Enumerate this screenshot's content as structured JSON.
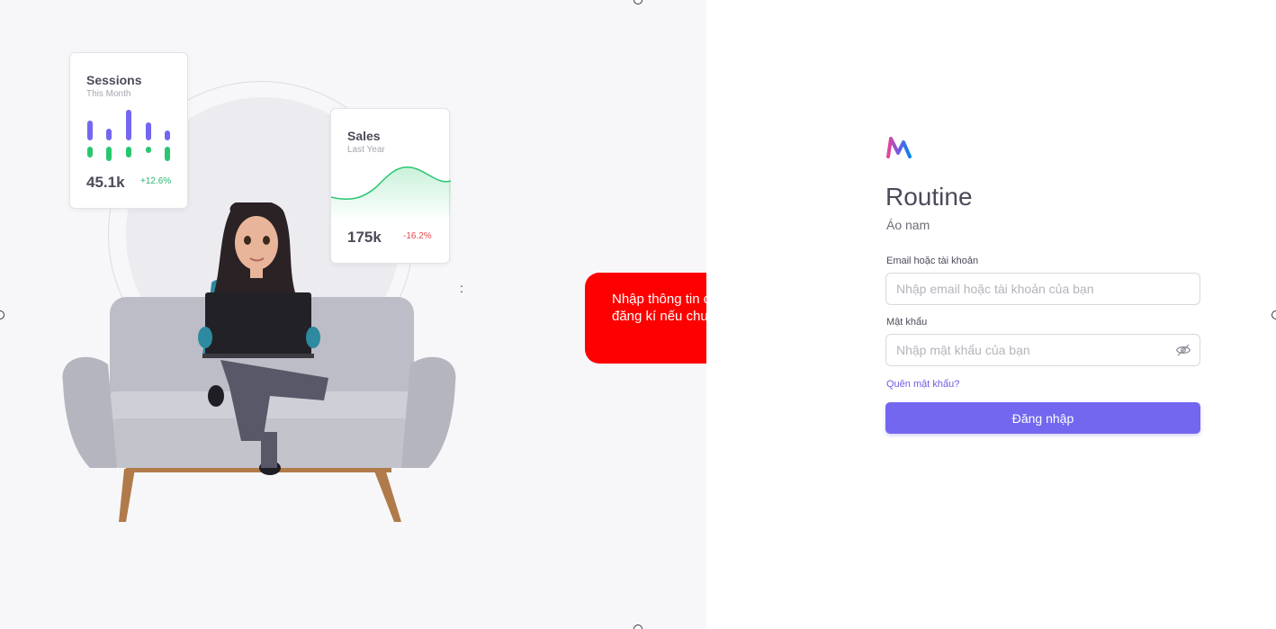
{
  "illustration": {
    "sessions_card": {
      "title": "Sessions",
      "subtitle": "This Month",
      "value": "45.1k",
      "delta": "+12.6%",
      "colors": {
        "top_bars": "#7367f0",
        "bottom_bars": "#28c76f"
      }
    },
    "sales_card": {
      "title": "Sales",
      "subtitle": "Last Year",
      "value": "175k",
      "delta": "-16.2%",
      "colors": {
        "line": "#28c76f"
      }
    },
    "dots_mark": ":"
  },
  "callout": {
    "text": "Nhập thông tin đăng nhập hoặc đăng kí nếu chưa có tài khoản"
  },
  "login": {
    "logo_icon": "brand-logo-icon",
    "app_title": "Routine",
    "app_subtitle": "Áo nam",
    "email_label": "Email hoặc tài khoản",
    "email_placeholder": "Nhập email hoặc tài khoản của bạn",
    "email_value": "",
    "password_label": "Mật khẩu",
    "password_placeholder": "Nhập mật khẩu của bạn",
    "password_value": "",
    "password_toggle_icon": "eye-off-icon",
    "forgot_password": "Quên mật khẩu?",
    "submit_label": "Đăng nhập",
    "accent_color": "#7367f0"
  }
}
